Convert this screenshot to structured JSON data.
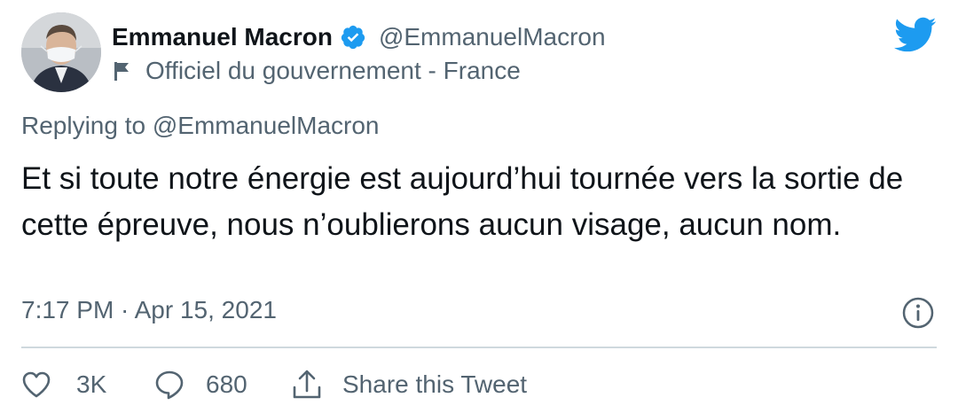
{
  "author": {
    "display_name": "Emmanuel Macron",
    "handle": "@EmmanuelMacron",
    "label": "Officiel du gouvernement - France",
    "verified": true,
    "avatar_icon": "person-portrait-with-mask"
  },
  "brand": {
    "icon": "twitter-bird-icon",
    "color": "#1d9bf0"
  },
  "tweet": {
    "replying_to": "Replying to @EmmanuelMacron",
    "text": "Et si toute notre énergie est aujourd’hui tournée vers la sortie de cette épreuve, nous n’oublierons aucun visage, aucun nom.",
    "timestamp": "7:17 PM · Apr 15, 2021"
  },
  "actions": {
    "like_count": "3K",
    "reply_count": "680",
    "share_label": "Share this Tweet"
  },
  "colors": {
    "primary_text": "#0f1419",
    "secondary_text": "#536471",
    "divider": "#cfd9de"
  }
}
